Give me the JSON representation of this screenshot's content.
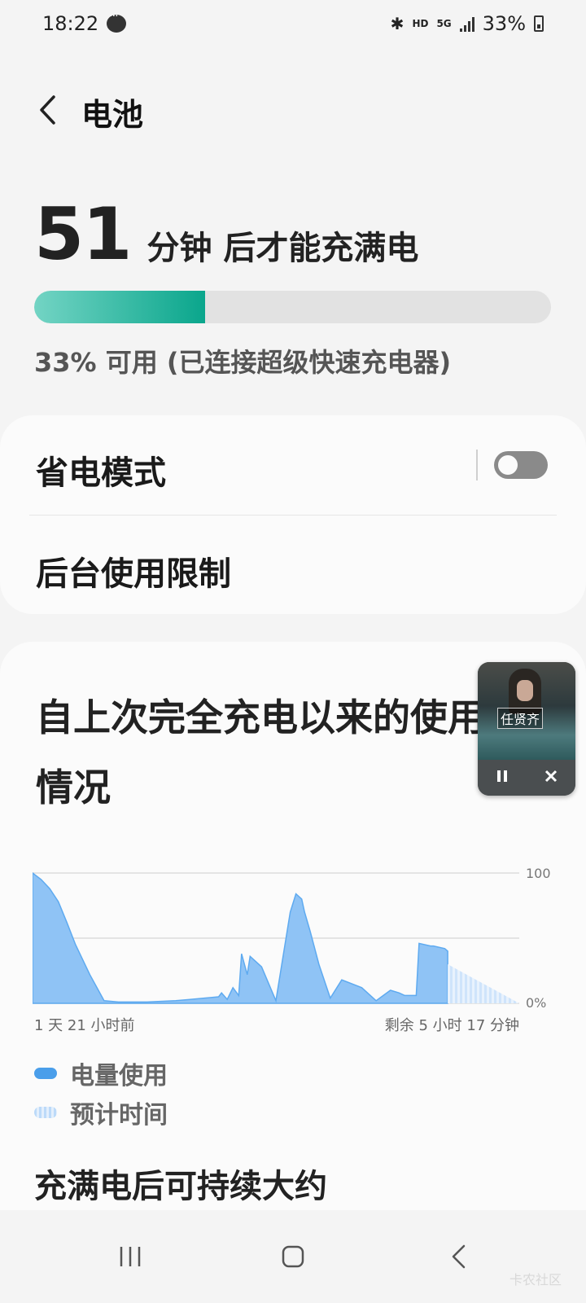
{
  "status_bar": {
    "time": "18:22",
    "hd": "HD",
    "network": "5G",
    "battery": "33%"
  },
  "header": {
    "title": "电池"
  },
  "charging": {
    "minutes": "51",
    "label": "分钟 后才能充满电",
    "progress_percent": 33,
    "status_text": "33% 可用 (已连接超级快速充电器)"
  },
  "settings": {
    "power_saving_label": "省电模式",
    "power_saving_enabled": false,
    "background_limit_label": "后台使用限制"
  },
  "usage": {
    "title": "自上次完全充电以来的使用情况",
    "start_label": "1 天 21 小时前",
    "end_label": "剩余 5 小时 17 分钟",
    "legend_usage": "电量使用",
    "legend_estimate": "预计时间",
    "after_full_title": "充满电后可持续大约"
  },
  "chart_data": {
    "type": "area",
    "ylim": [
      0,
      100
    ],
    "ytick_labels": [
      "100",
      "0%"
    ],
    "x": [
      0,
      3,
      6,
      9,
      12,
      15,
      20,
      25,
      30,
      40,
      50,
      55,
      60,
      65,
      66,
      68,
      70,
      72,
      73,
      75,
      76,
      78,
      80,
      85,
      90,
      92,
      94,
      95,
      97,
      100,
      104,
      108,
      115,
      120,
      125,
      128,
      130,
      134,
      135,
      139,
      140,
      144,
      145,
      150,
      155,
      160,
      165,
      170
    ],
    "series": [
      {
        "values": [
          100,
          95,
          88,
          78,
          62,
          45,
          22,
          2,
          1,
          1,
          2,
          3,
          4,
          5,
          8,
          3,
          12,
          6,
          38,
          22,
          36,
          32,
          28,
          2,
          70,
          84,
          80,
          70,
          55,
          30,
          4,
          18,
          12,
          2,
          10,
          8,
          6,
          6,
          46,
          44,
          44,
          42,
          40,
          38,
          36,
          34,
          32,
          30
        ]
      },
      {
        "values": [
          30,
          24,
          18,
          12,
          6,
          0
        ]
      }
    ],
    "estimate_start_x": 145,
    "grid": true,
    "colors": {
      "usage": "#5eaaf0",
      "estimate": "#c7e1fb"
    }
  },
  "mini_player": {
    "album_text": "任贤齐",
    "pause_icon": "pause-icon",
    "close_icon": "close-icon"
  },
  "watermark": "卡农社区",
  "colors": {
    "accent": "#0aa68c",
    "accent_light": "#73d4c4",
    "chart_blue": "#5eaaf0"
  }
}
